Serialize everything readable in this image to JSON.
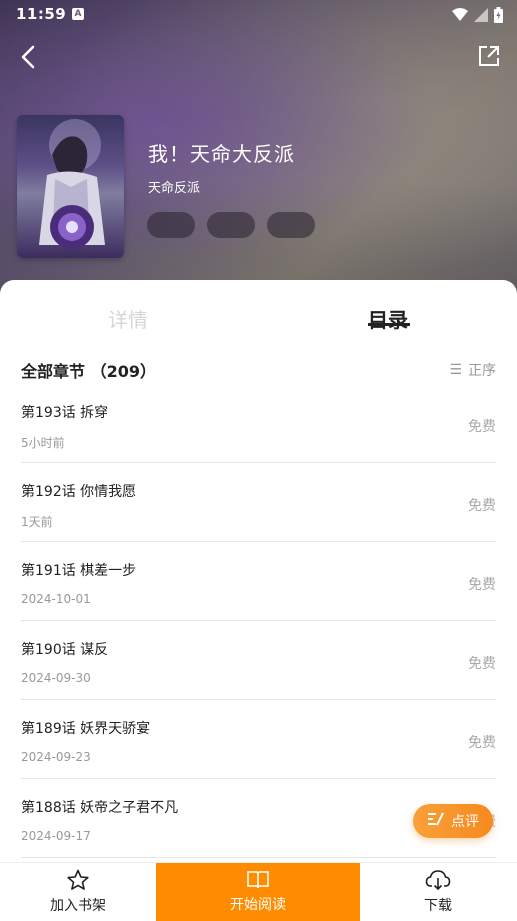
{
  "status_bar": {
    "time": "11:59",
    "notification": "A"
  },
  "header": {
    "back": "back",
    "share": "share"
  },
  "book": {
    "title": "我！天命大反派",
    "author": "天命反派",
    "tags": [
      "",
      "",
      ""
    ]
  },
  "tabs": {
    "details": "详情",
    "catalog": "目录"
  },
  "section": {
    "title": "全部章节 （209）",
    "sort_label": "正序",
    "sort_icon": "☰"
  },
  "chapters": [
    {
      "name": "第193话 拆穿",
      "date": "5小时前",
      "price": "免费"
    },
    {
      "name": "第192话 你情我愿",
      "date": "1天前",
      "price": "免费"
    },
    {
      "name": "第191话 棋差一步",
      "date": "2024-10-01",
      "price": "免费"
    },
    {
      "name": "第190话 谋反",
      "date": "2024-09-30",
      "price": "免费"
    },
    {
      "name": "第189话 妖界天骄宴",
      "date": "2024-09-23",
      "price": "免费"
    },
    {
      "name": "第188话 妖帝之子君不凡",
      "date": "2024-09-17",
      "price": "免费"
    }
  ],
  "review_button": {
    "label": "点评"
  },
  "bottom_bar": {
    "shelf": "加入书架",
    "read": "开始阅读",
    "download": "下载"
  },
  "colors": {
    "accent": "#ff8c00",
    "review": "#f68a1e"
  }
}
